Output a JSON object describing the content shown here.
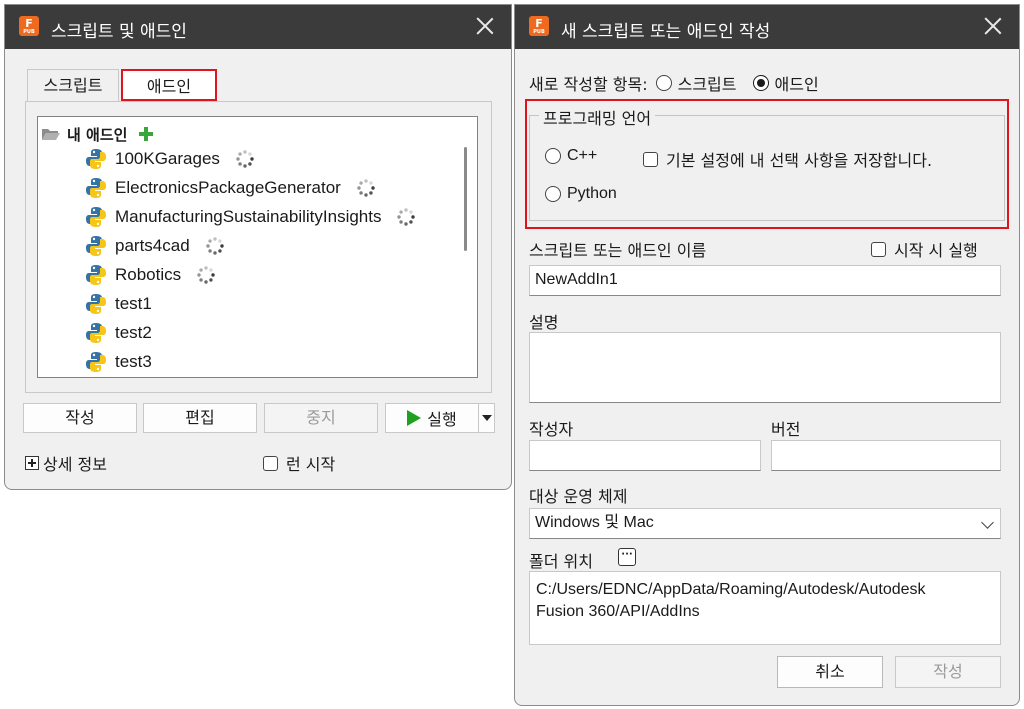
{
  "left_window": {
    "title": "스크립트 및 애드인",
    "app_icon_letter": "F",
    "app_icon_sub": "PUB",
    "tabs": [
      {
        "label": "스크립트",
        "active": false
      },
      {
        "label": "애드인",
        "active": true
      }
    ],
    "tree": {
      "root_label": "내 애드인",
      "items": [
        {
          "label": "100KGarages",
          "loading": true
        },
        {
          "label": "ElectronicsPackageGenerator",
          "loading": true
        },
        {
          "label": "ManufacturingSustainabilityInsights",
          "loading": true
        },
        {
          "label": "parts4cad",
          "loading": true
        },
        {
          "label": "Robotics",
          "loading": true
        },
        {
          "label": "test1",
          "loading": false
        },
        {
          "label": "test2",
          "loading": false
        },
        {
          "label": "test3",
          "loading": false
        }
      ]
    },
    "buttons": {
      "create": "작성",
      "edit": "편집",
      "stop": "중지",
      "run": "실행"
    },
    "details_label": "상세 정보",
    "run_on_startup_label": "런 시작"
  },
  "right_window": {
    "title": "새 스크립트 또는 애드인 작성",
    "create_type_label": "새로 작성할 항목:",
    "create_type_options": [
      {
        "label": "스크립트",
        "selected": false
      },
      {
        "label": "애드인",
        "selected": true
      }
    ],
    "language_group_label": "프로그래밍 언어",
    "languages": [
      {
        "label": "C++",
        "selected": false
      },
      {
        "label": "Python",
        "selected": false
      }
    ],
    "save_preference_label": "기본 설정에 내 선택 사항을 저장합니다.",
    "name_label": "스크립트 또는 애드인 이름",
    "run_on_startup_label": "시작 시 실행",
    "name_value": "NewAddIn1",
    "description_label": "설명",
    "description_value": "",
    "author_label": "작성자",
    "author_value": "",
    "version_label": "버전",
    "version_value": "",
    "target_os_label": "대상 운영 체제",
    "target_os_value": "Windows 및 Mac",
    "folder_label": "폴더 위치",
    "folder_button": "···",
    "folder_path_line1": "C:/Users/EDNC/AppData/Roaming/Autodesk/Autodesk",
    "folder_path_line2": "Fusion 360/API/AddIns",
    "buttons": {
      "cancel": "취소",
      "create": "작성"
    }
  },
  "colors": {
    "titlebar": "#3b3b3b",
    "highlight_red": "#e0141e",
    "app_icon_orange": "#ee6a1f",
    "run_green": "#1ea11e",
    "add_green": "#3aa53a"
  }
}
